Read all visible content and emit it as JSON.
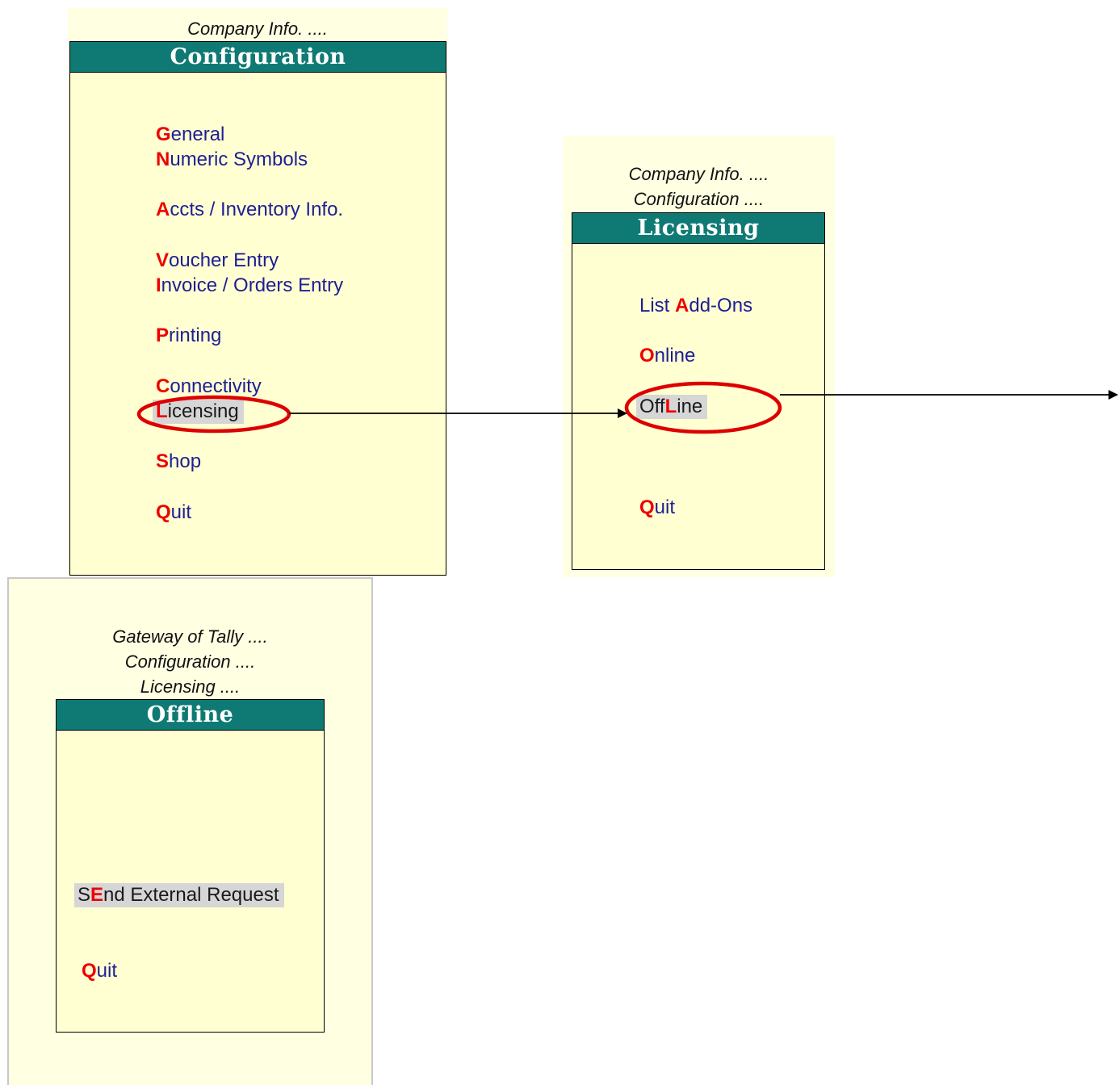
{
  "configuration_screen": {
    "breadcrumbs": [
      "Company Info. ...."
    ],
    "title": "Configuration",
    "items": [
      {
        "hotkey": "G",
        "rest": "eneral"
      },
      {
        "hotkey": "N",
        "rest": "umeric Symbols"
      },
      {
        "hotkey": "A",
        "rest": "ccts / Inventory Info."
      },
      {
        "hotkey": "V",
        "rest": "oucher Entry"
      },
      {
        "hotkey": "I",
        "rest": "nvoice / Orders Entry"
      },
      {
        "hotkey": "P",
        "rest": "rinting"
      },
      {
        "hotkey": "C",
        "rest": "onnectivity"
      },
      {
        "hotkey": "L",
        "rest": "icensing",
        "selected": true
      },
      {
        "hotkey": "S",
        "rest": "hop"
      },
      {
        "hotkey": "Q",
        "rest": "uit"
      }
    ]
  },
  "licensing_screen": {
    "breadcrumbs": [
      "Company Info. ....",
      "Configuration ...."
    ],
    "title": "Licensing",
    "items": [
      {
        "before": "List ",
        "hotkey": "A",
        "rest": "dd-Ons"
      },
      {
        "before": "",
        "hotkey": "O",
        "rest": "nline"
      },
      {
        "before": "Off",
        "hotkey": "L",
        "rest": "ine",
        "selected": true
      },
      {
        "before": "",
        "hotkey": "Q",
        "rest": "uit"
      }
    ]
  },
  "offline_screen": {
    "breadcrumbs": [
      "Gateway of Tally ....",
      "Configuration ....",
      "Licensing ...."
    ],
    "title": "Offline",
    "items": [
      {
        "before": "S",
        "hotkey": "E",
        "rest": "nd External Request",
        "selected": true
      },
      {
        "before": "",
        "hotkey": "Q",
        "rest": "uit"
      }
    ]
  },
  "annotation_colors": {
    "highlight_ellipse": "#dd0000",
    "arrow": "#000000"
  }
}
